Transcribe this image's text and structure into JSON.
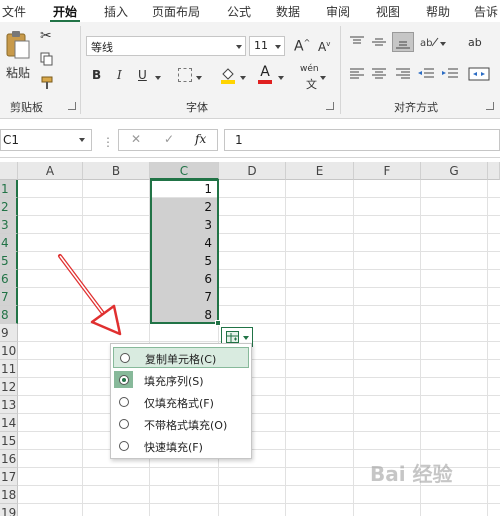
{
  "menu": {
    "tabs": [
      "文件",
      "开始",
      "插入",
      "页面布局",
      "公式",
      "数据",
      "审阅",
      "视图",
      "帮助",
      "告诉"
    ],
    "active": "开始"
  },
  "ribbon": {
    "clipboard": {
      "paste_label": "粘贴",
      "group_label": "剪贴板"
    },
    "font": {
      "font_name": "等线",
      "font_size": "11",
      "grow_label": "A",
      "shrink_label": "A",
      "bold": "B",
      "italic": "I",
      "underline": "U",
      "font_color_label": "A",
      "phonetic_label": "wén",
      "group_label": "字体"
    },
    "alignment": {
      "group_label": "对齐方式",
      "wrap_label": "ab"
    }
  },
  "formula_bar": {
    "name_box": "C1",
    "cancel": "✕",
    "enter": "✓",
    "fx": "fx",
    "value": "1"
  },
  "grid": {
    "columns": [
      "A",
      "B",
      "C",
      "D",
      "E",
      "F",
      "G"
    ],
    "rows": [
      "1",
      "2",
      "3",
      "4",
      "5",
      "6",
      "7",
      "8",
      "9",
      "10",
      "11",
      "12",
      "13",
      "14",
      "15",
      "16",
      "17",
      "18",
      "19"
    ],
    "selected_column": "C",
    "column_c_values": [
      "1",
      "2",
      "3",
      "4",
      "5",
      "6",
      "7",
      "8"
    ]
  },
  "autofill_options": {
    "items": [
      {
        "label": "复制单元格(C)",
        "state": "hover"
      },
      {
        "label": "填充序列(S)",
        "state": "checked"
      },
      {
        "label": "仅填充格式(F)",
        "state": ""
      },
      {
        "label": "不带格式填充(O)",
        "state": ""
      },
      {
        "label": "快速填充(F)",
        "state": ""
      }
    ]
  },
  "watermark": "Bai 经验",
  "colors": {
    "accent": "#217346",
    "arrow": "#e03030",
    "selection_fill": "#d0d0d0"
  }
}
